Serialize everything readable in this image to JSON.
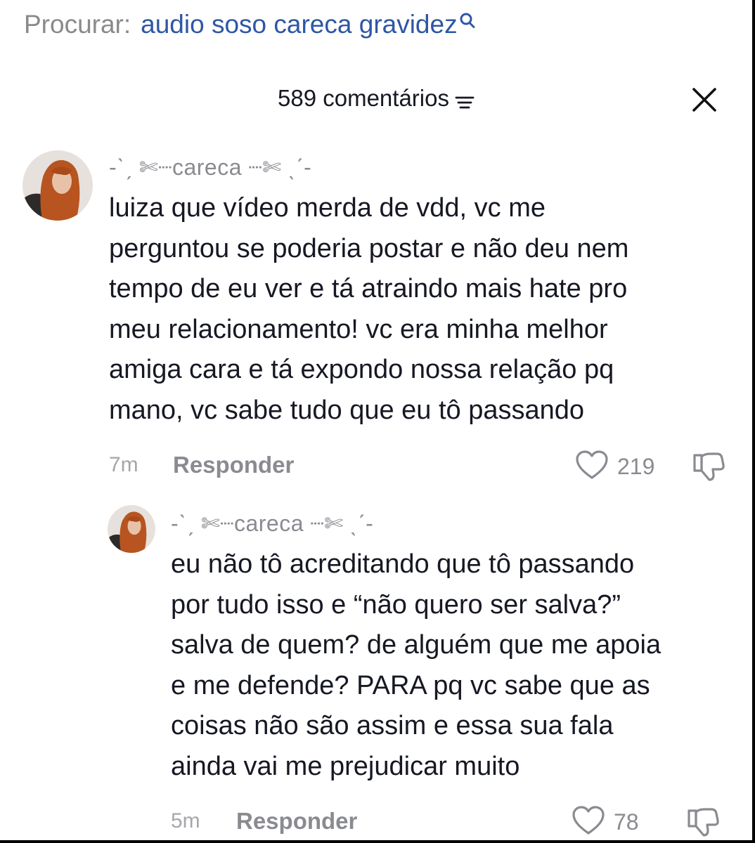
{
  "search": {
    "prefix": "Procurar:",
    "query": "audio soso careca gravidez",
    "icon": "search-icon"
  },
  "header": {
    "comment_count": "589 comentários",
    "sort_icon": "sort-icon",
    "close_icon": "close-icon"
  },
  "comments": [
    {
      "username": "-ˋˏ ✄┈careca ┈✄ ˎˊ-",
      "lines": [
        "luiza que vídeo merda de vdd, vc me",
        "perguntou se poderia postar e não deu nem",
        "tempo de eu ver e tá atraindo mais hate pro",
        "meu relacionamento! vc era minha melhor",
        "amiga cara e tá expondo nossa relação pq",
        "mano, vc sabe tudo que eu tô passando"
      ],
      "time": "7m",
      "reply_label": "Responder",
      "likes": "219"
    },
    {
      "username": "-ˋˏ ✄┈careca ┈✄ ˎˊ-",
      "lines": [
        "eu não tô acreditando que tô passando",
        "por tudo isso e “não quero ser salva?”",
        "salva de quem? de alguém que me apoia",
        "e me defende? PARA pq vc sabe que as",
        "coisas não são assim e essa sua fala",
        "ainda vai me prejudicar muito"
      ],
      "time": "5m",
      "reply_label": "Responder",
      "likes": "78"
    }
  ],
  "colors": {
    "search_query": "#2f56a6",
    "text_primary": "#161823",
    "text_secondary": "#8a8b91"
  }
}
